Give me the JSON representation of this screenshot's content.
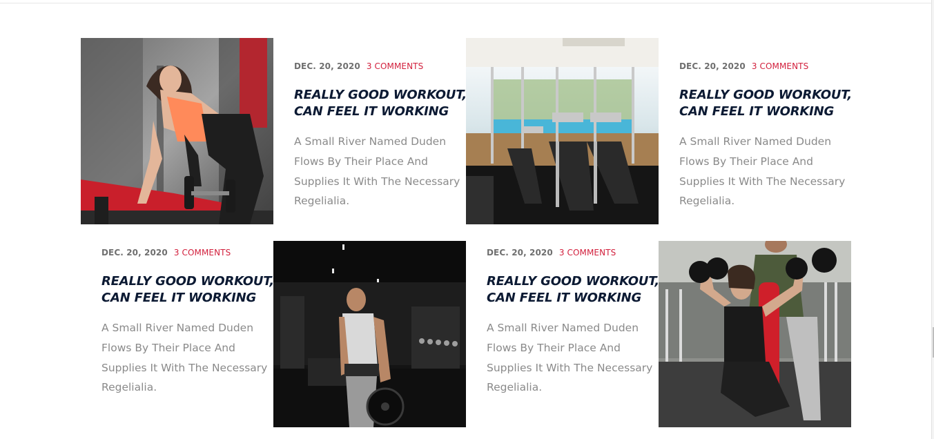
{
  "posts": [
    {
      "date": "DEC. 20, 2020",
      "comments": "3 COMMENTS",
      "title_line1": "REALLY GOOD WORKOUT,",
      "title_line2": "CAN FEEL IT WORKING",
      "excerpt_line1": "A Small River Named Duden",
      "excerpt_line2": "Flows By Their Place And",
      "excerpt_line3": "Supplies It With The Necessary",
      "excerpt_line4": "Regelialia."
    },
    {
      "date": "DEC. 20, 2020",
      "comments": "3 COMMENTS",
      "title_line1": "REALLY GOOD WORKOUT,",
      "title_line2": "CAN FEEL IT WORKING",
      "excerpt_line1": "A Small River Named Duden",
      "excerpt_line2": "Flows By Their Place And",
      "excerpt_line3": "Supplies It With The Necessary",
      "excerpt_line4": "Regelialia."
    },
    {
      "date": "DEC. 20, 2020",
      "comments": "3 COMMENTS",
      "title_line1": "REALLY GOOD WORKOUT,",
      "title_line2": "CAN FEEL IT WORKING",
      "excerpt_line1": "A Small River Named Duden",
      "excerpt_line2": "Flows By Their Place And",
      "excerpt_line3": "Supplies It With The Necessary",
      "excerpt_line4": "Regelialia."
    },
    {
      "date": "DEC. 20, 2020",
      "comments": "3 COMMENTS",
      "title_line1": "REALLY GOOD WORKOUT,",
      "title_line2": "CAN FEEL IT WORKING",
      "excerpt_line1": "A Small River Named Duden",
      "excerpt_line2": "Flows By Their Place And",
      "excerpt_line3": "Supplies It With The Necessary",
      "excerpt_line4": "Regelialia."
    }
  ],
  "images": [
    {
      "subject": "woman doing dumbbell row on red bench in gym"
    },
    {
      "subject": "treadmills facing pool through glass windows"
    },
    {
      "subject": "man with weight plate in dark gym"
    },
    {
      "subject": "woman pressing dumbbells with trainer spotting"
    }
  ],
  "colors": {
    "accent": "#d21f3c",
    "title": "#0c1a33",
    "meta": "#6f6f6f",
    "excerpt": "#8a8a8a"
  }
}
